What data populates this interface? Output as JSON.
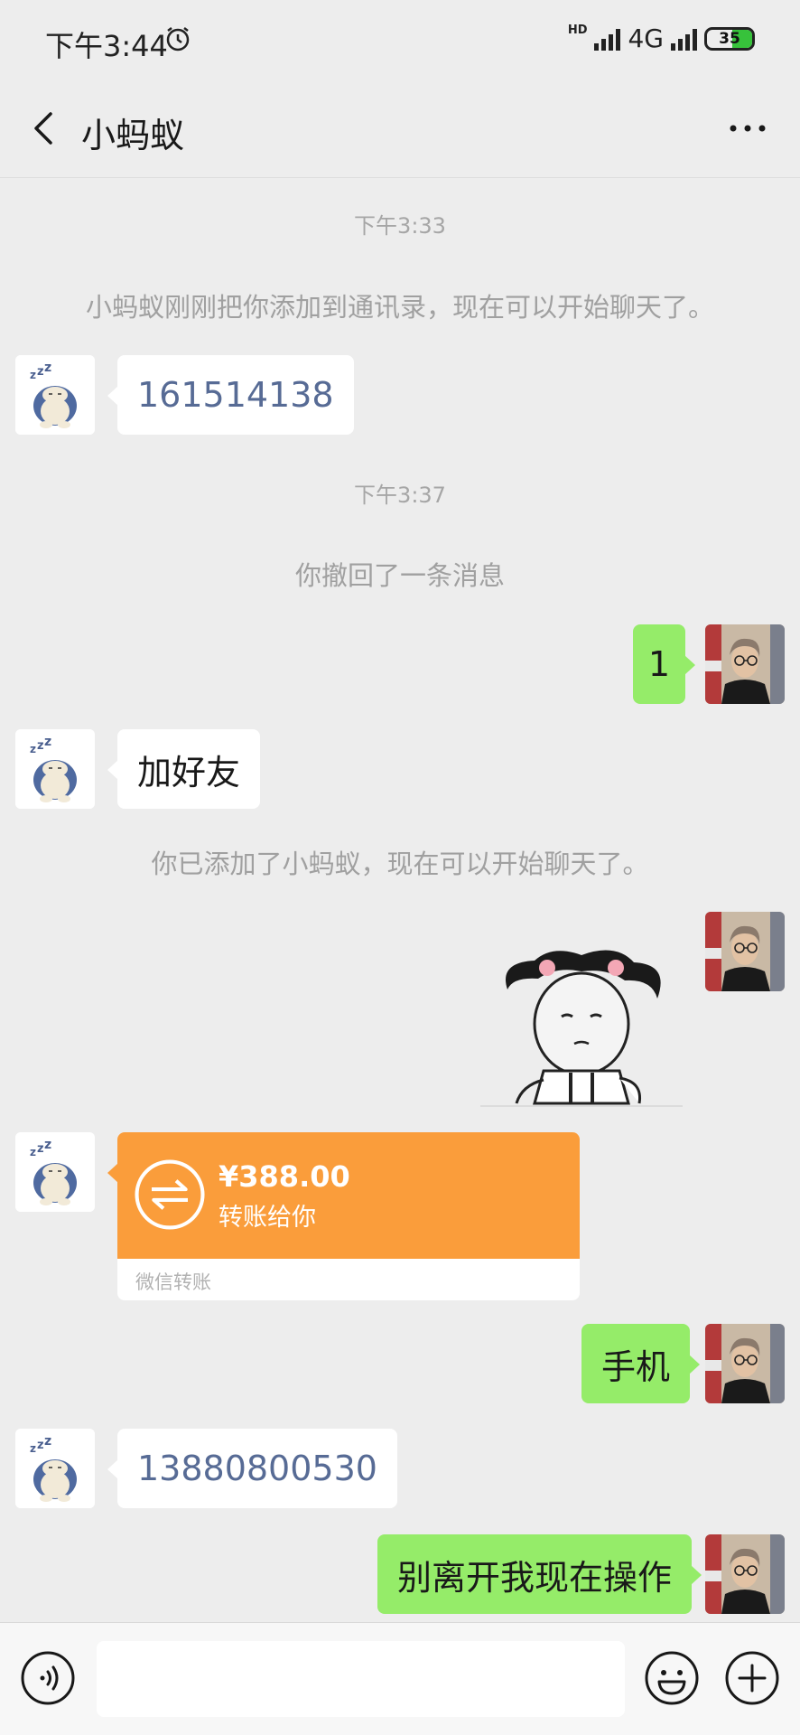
{
  "status_bar": {
    "time": "下午3:44",
    "network_hd": "HD",
    "network": "4G",
    "battery": "35"
  },
  "header": {
    "title": "小蚂蚁",
    "back_icon": "chevron-left-icon",
    "more_icon": "ellipsis-icon"
  },
  "messages": {
    "time1": "下午3:33",
    "added_notice": "小蚂蚁刚刚把你添加到通讯录，现在可以开始聊天了。",
    "msg1": "161514138",
    "time2": "下午3:37",
    "recall_notice": "你撤回了一条消息",
    "msg2": "1",
    "msg3": "加好友",
    "friend_notice": "你已添加了小蚂蚁，现在可以开始聊天了。",
    "transfer": {
      "amount": "¥388.00",
      "desc": "转账给你",
      "footer": "微信转账",
      "color": "#fa9d3b"
    },
    "msg4": "手机",
    "msg5": "13880800530",
    "msg6": "别离开我现在操作"
  },
  "input_bar": {
    "voice_icon": "voice-icon",
    "emoji_icon": "emoji-icon",
    "plus_icon": "plus-icon",
    "text": ""
  },
  "colors": {
    "background": "#ededed",
    "bubble_sent": "#95ec69",
    "bubble_received": "#ffffff",
    "link_number": "#576b95"
  }
}
